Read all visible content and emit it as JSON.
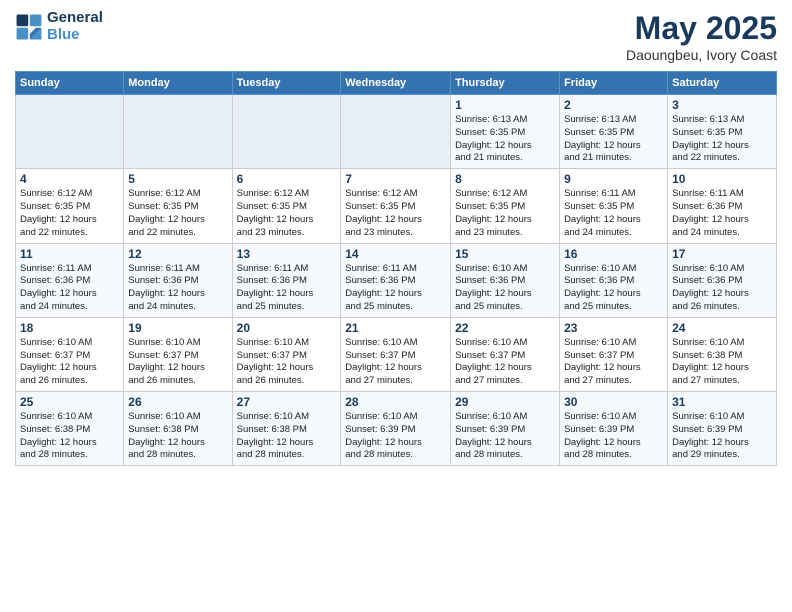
{
  "header": {
    "logo_line1": "General",
    "logo_line2": "Blue",
    "month_year": "May 2025",
    "location": "Daoungbeu, Ivory Coast"
  },
  "weekdays": [
    "Sunday",
    "Monday",
    "Tuesday",
    "Wednesday",
    "Thursday",
    "Friday",
    "Saturday"
  ],
  "weeks": [
    [
      {
        "day": "",
        "detail": ""
      },
      {
        "day": "",
        "detail": ""
      },
      {
        "day": "",
        "detail": ""
      },
      {
        "day": "",
        "detail": ""
      },
      {
        "day": "1",
        "detail": "Sunrise: 6:13 AM\nSunset: 6:35 PM\nDaylight: 12 hours\nand 21 minutes."
      },
      {
        "day": "2",
        "detail": "Sunrise: 6:13 AM\nSunset: 6:35 PM\nDaylight: 12 hours\nand 21 minutes."
      },
      {
        "day": "3",
        "detail": "Sunrise: 6:13 AM\nSunset: 6:35 PM\nDaylight: 12 hours\nand 22 minutes."
      }
    ],
    [
      {
        "day": "4",
        "detail": "Sunrise: 6:12 AM\nSunset: 6:35 PM\nDaylight: 12 hours\nand 22 minutes."
      },
      {
        "day": "5",
        "detail": "Sunrise: 6:12 AM\nSunset: 6:35 PM\nDaylight: 12 hours\nand 22 minutes."
      },
      {
        "day": "6",
        "detail": "Sunrise: 6:12 AM\nSunset: 6:35 PM\nDaylight: 12 hours\nand 23 minutes."
      },
      {
        "day": "7",
        "detail": "Sunrise: 6:12 AM\nSunset: 6:35 PM\nDaylight: 12 hours\nand 23 minutes."
      },
      {
        "day": "8",
        "detail": "Sunrise: 6:12 AM\nSunset: 6:35 PM\nDaylight: 12 hours\nand 23 minutes."
      },
      {
        "day": "9",
        "detail": "Sunrise: 6:11 AM\nSunset: 6:35 PM\nDaylight: 12 hours\nand 24 minutes."
      },
      {
        "day": "10",
        "detail": "Sunrise: 6:11 AM\nSunset: 6:36 PM\nDaylight: 12 hours\nand 24 minutes."
      }
    ],
    [
      {
        "day": "11",
        "detail": "Sunrise: 6:11 AM\nSunset: 6:36 PM\nDaylight: 12 hours\nand 24 minutes."
      },
      {
        "day": "12",
        "detail": "Sunrise: 6:11 AM\nSunset: 6:36 PM\nDaylight: 12 hours\nand 24 minutes."
      },
      {
        "day": "13",
        "detail": "Sunrise: 6:11 AM\nSunset: 6:36 PM\nDaylight: 12 hours\nand 25 minutes."
      },
      {
        "day": "14",
        "detail": "Sunrise: 6:11 AM\nSunset: 6:36 PM\nDaylight: 12 hours\nand 25 minutes."
      },
      {
        "day": "15",
        "detail": "Sunrise: 6:10 AM\nSunset: 6:36 PM\nDaylight: 12 hours\nand 25 minutes."
      },
      {
        "day": "16",
        "detail": "Sunrise: 6:10 AM\nSunset: 6:36 PM\nDaylight: 12 hours\nand 25 minutes."
      },
      {
        "day": "17",
        "detail": "Sunrise: 6:10 AM\nSunset: 6:36 PM\nDaylight: 12 hours\nand 26 minutes."
      }
    ],
    [
      {
        "day": "18",
        "detail": "Sunrise: 6:10 AM\nSunset: 6:37 PM\nDaylight: 12 hours\nand 26 minutes."
      },
      {
        "day": "19",
        "detail": "Sunrise: 6:10 AM\nSunset: 6:37 PM\nDaylight: 12 hours\nand 26 minutes."
      },
      {
        "day": "20",
        "detail": "Sunrise: 6:10 AM\nSunset: 6:37 PM\nDaylight: 12 hours\nand 26 minutes."
      },
      {
        "day": "21",
        "detail": "Sunrise: 6:10 AM\nSunset: 6:37 PM\nDaylight: 12 hours\nand 27 minutes."
      },
      {
        "day": "22",
        "detail": "Sunrise: 6:10 AM\nSunset: 6:37 PM\nDaylight: 12 hours\nand 27 minutes."
      },
      {
        "day": "23",
        "detail": "Sunrise: 6:10 AM\nSunset: 6:37 PM\nDaylight: 12 hours\nand 27 minutes."
      },
      {
        "day": "24",
        "detail": "Sunrise: 6:10 AM\nSunset: 6:38 PM\nDaylight: 12 hours\nand 27 minutes."
      }
    ],
    [
      {
        "day": "25",
        "detail": "Sunrise: 6:10 AM\nSunset: 6:38 PM\nDaylight: 12 hours\nand 28 minutes."
      },
      {
        "day": "26",
        "detail": "Sunrise: 6:10 AM\nSunset: 6:38 PM\nDaylight: 12 hours\nand 28 minutes."
      },
      {
        "day": "27",
        "detail": "Sunrise: 6:10 AM\nSunset: 6:38 PM\nDaylight: 12 hours\nand 28 minutes."
      },
      {
        "day": "28",
        "detail": "Sunrise: 6:10 AM\nSunset: 6:39 PM\nDaylight: 12 hours\nand 28 minutes."
      },
      {
        "day": "29",
        "detail": "Sunrise: 6:10 AM\nSunset: 6:39 PM\nDaylight: 12 hours\nand 28 minutes."
      },
      {
        "day": "30",
        "detail": "Sunrise: 6:10 AM\nSunset: 6:39 PM\nDaylight: 12 hours\nand 28 minutes."
      },
      {
        "day": "31",
        "detail": "Sunrise: 6:10 AM\nSunset: 6:39 PM\nDaylight: 12 hours\nand 29 minutes."
      }
    ]
  ]
}
